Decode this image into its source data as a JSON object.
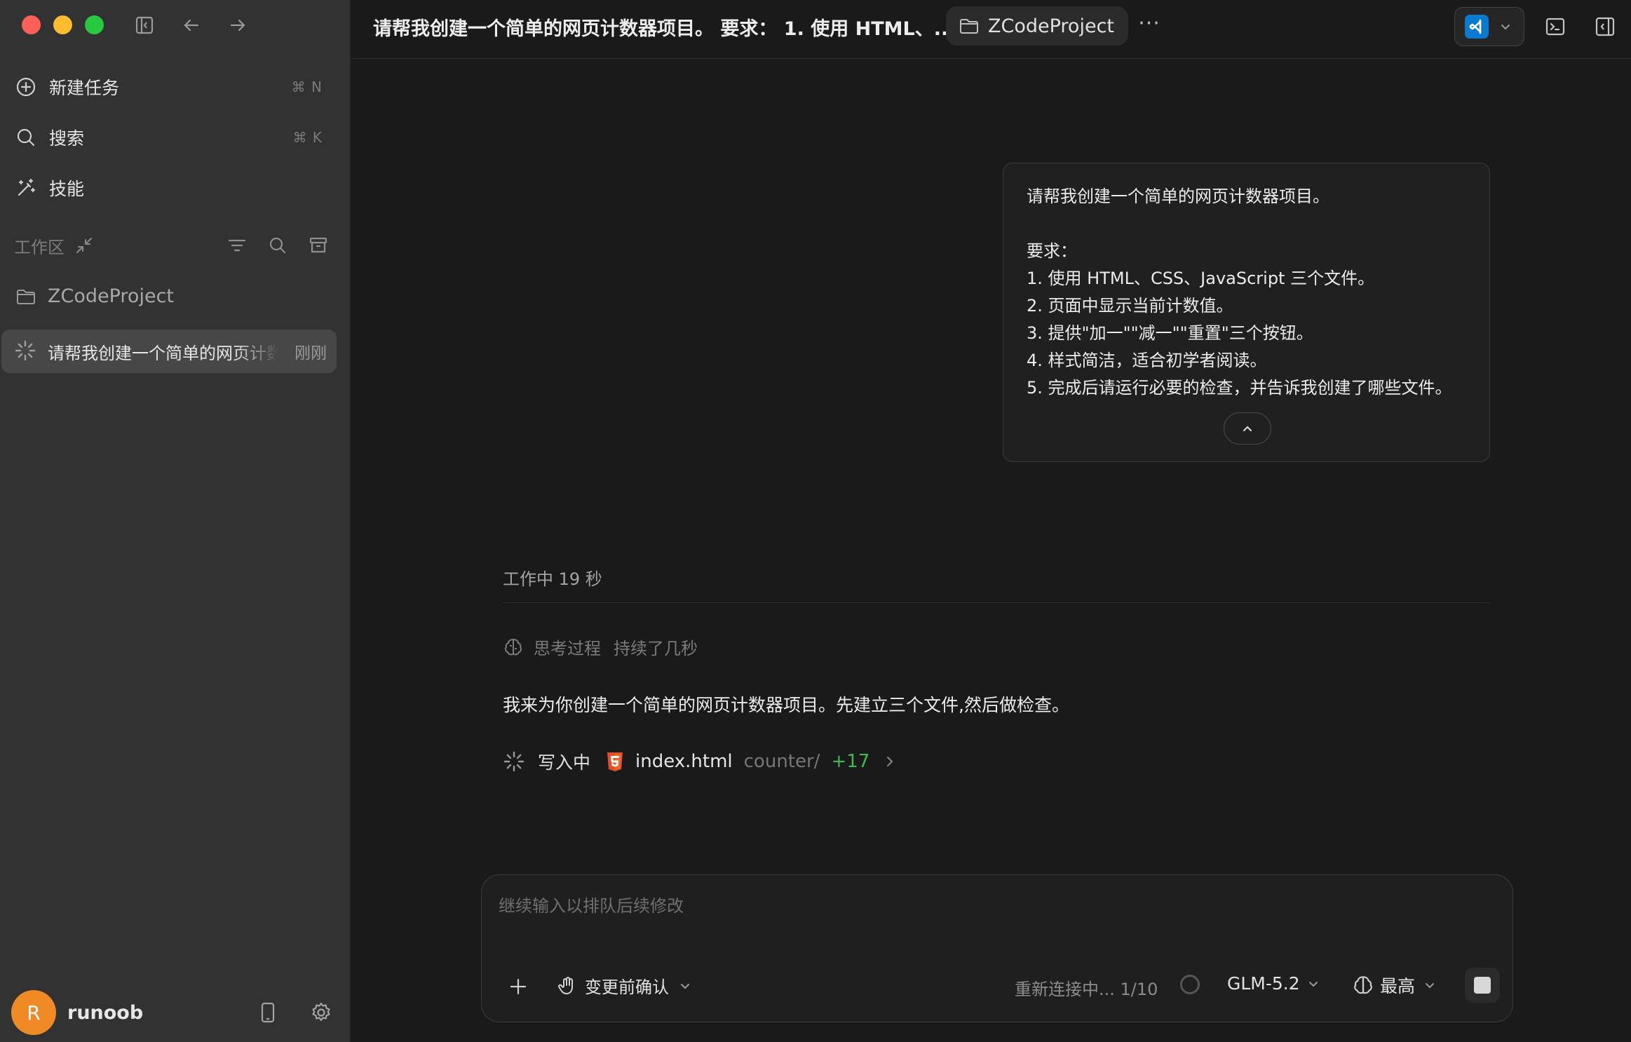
{
  "app": {
    "window_title": "请帮我创建一个简单的网页计数器项目。 要求： 1. 使用 HTML、...",
    "project_chip": "ZCodeProject",
    "more": "···"
  },
  "sidebar": {
    "nav": [
      {
        "label": "新建任务",
        "shortcut": "⌘ N",
        "icon": "plus-circle-icon"
      },
      {
        "label": "搜索",
        "shortcut": "⌘ K",
        "icon": "search-icon"
      },
      {
        "label": "技能",
        "shortcut": "",
        "icon": "magic-wand-icon"
      }
    ],
    "workspace_label": "工作区",
    "project": {
      "name": "ZCodeProject",
      "icon": "folder-icon"
    },
    "task": {
      "title": "请帮我创建一个简单的网页计数器项目。",
      "time": "刚刚"
    },
    "user": {
      "initial": "R",
      "name": "runoob"
    }
  },
  "conversation": {
    "user_message": [
      "请帮我创建一个简单的网页计数器项目。",
      "",
      "要求：",
      "1. 使用 HTML、CSS、JavaScript 三个文件。",
      "2. 页面中显示当前计数值。",
      "3. 提供\"加一\"\"减一\"\"重置\"三个按钮。",
      "4. 样式简洁，适合初学者阅读。",
      "5. 完成后请运行必要的检查，并告诉我创建了哪些文件。"
    ],
    "work_status": "工作中 19 秒",
    "thinking": {
      "label": "思考过程",
      "duration": "持续了几秒"
    },
    "assistant_text": "我来为你创建一个简单的网页计数器项目。先建立三个文件,然后做检查。",
    "write_op": {
      "label": "写入中",
      "file": "index.html",
      "dir": "counter/",
      "diff": "+17"
    }
  },
  "composer": {
    "placeholder": "继续输入以排队后续修改",
    "confirm_mode": "变更前确认",
    "reconnect": "重新连接中... 1/10",
    "model": "GLM-5.2",
    "effort": "最高"
  },
  "colors": {
    "accent_orange": "#f08a24",
    "diff_green": "#3fb950",
    "vscode_blue": "#0a7ad1"
  }
}
